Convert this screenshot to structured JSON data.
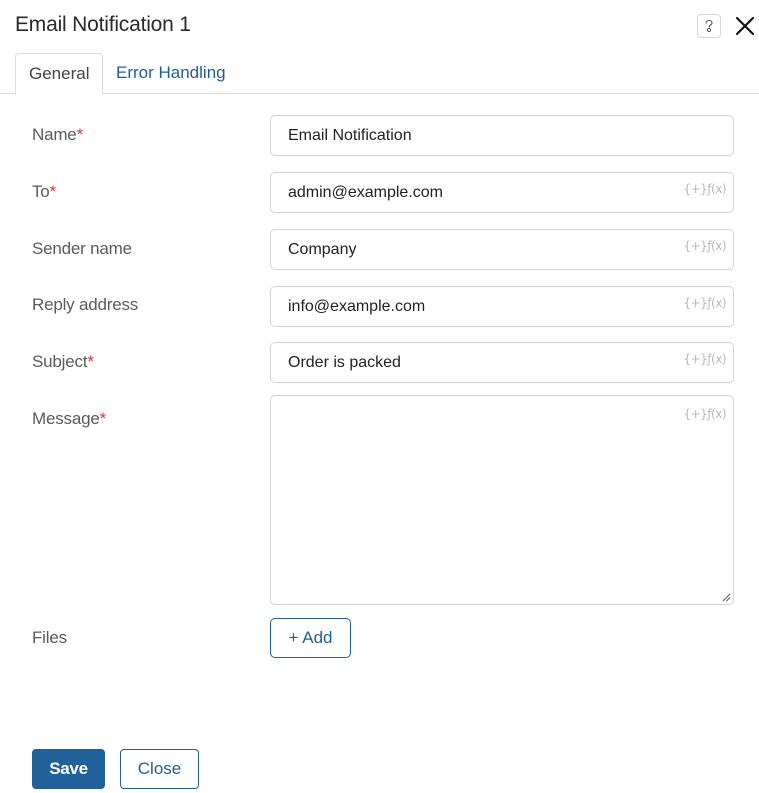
{
  "dialog": {
    "title": "Email Notification 1",
    "help_icon": "question-icon",
    "close_icon": "close-icon"
  },
  "tabs": [
    {
      "label": "General",
      "active": true
    },
    {
      "label": "Error Handling",
      "active": false
    }
  ],
  "form": {
    "required_marker": "*",
    "variable_picker_label": "{+}ƒ(x)",
    "fields": [
      {
        "label": "Name",
        "required": true,
        "value": "Email Notification",
        "has_variable_picker": false
      },
      {
        "label": "To",
        "required": true,
        "value": "admin@example.com",
        "has_variable_picker": true
      },
      {
        "label": "Sender name",
        "required": false,
        "value": "Company",
        "has_variable_picker": true
      },
      {
        "label": "Reply address",
        "required": false,
        "value": "info@example.com",
        "has_variable_picker": true
      },
      {
        "label": "Subject",
        "required": true,
        "value": "Order is packed",
        "has_variable_picker": true
      }
    ],
    "message": {
      "label": "Message",
      "required": true,
      "value": ""
    },
    "files": {
      "label": "Files",
      "add_label": "+ Add"
    }
  },
  "footer": {
    "save_label": "Save",
    "close_label": "Close"
  },
  "colors": {
    "accent": "#1f6198",
    "link": "#1f5f96",
    "required": "#e03030",
    "border": "#d3d3d3"
  }
}
